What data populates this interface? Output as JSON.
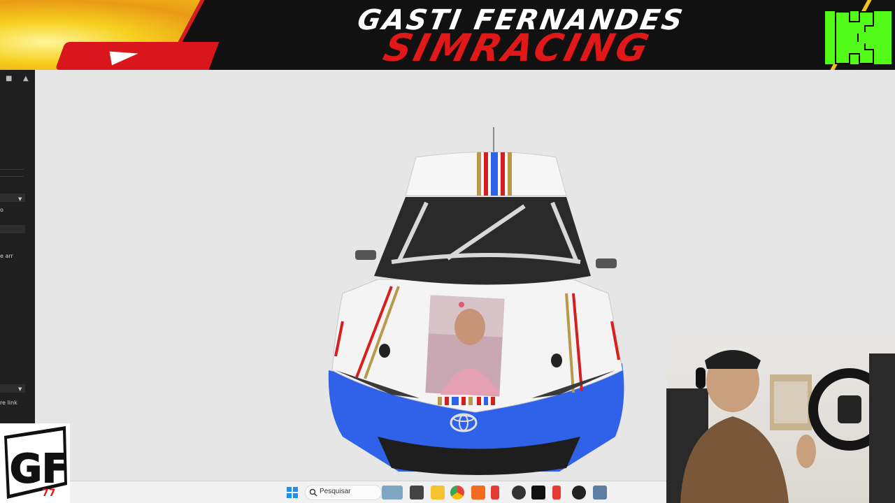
{
  "banner": {
    "line1": "GASTI FERNANDES",
    "line2": "SIMRACING",
    "platform_icons": [
      "youtube-icon",
      "kick-icon"
    ],
    "colors": {
      "red": "#e01818",
      "yellow": "#f1c21b",
      "kick_green": "#53fc18"
    }
  },
  "left_panel": {
    "items": [
      {
        "text": "o"
      },
      {
        "text": "e arr"
      },
      {
        "text": "re link"
      }
    ]
  },
  "car": {
    "make_logo": "toyota-logo",
    "livery_colors": [
      "#ffffff",
      "#2f62e8",
      "#d42020",
      "#b89a4a"
    ]
  },
  "taskbar": {
    "search_label": "Pesquisar",
    "icons": [
      "windows-start-icon",
      "search-icon",
      "widgets-icon",
      "task-view-icon",
      "file-explorer-icon",
      "chrome-icon",
      "brave-icon",
      "app-red-icon",
      "app-icon",
      "terminal-icon",
      "app-red-2-icon",
      "app-circle-icon",
      "app-settings-icon"
    ]
  },
  "overlay": {
    "logo_text": "GF",
    "logo_number": "77"
  }
}
